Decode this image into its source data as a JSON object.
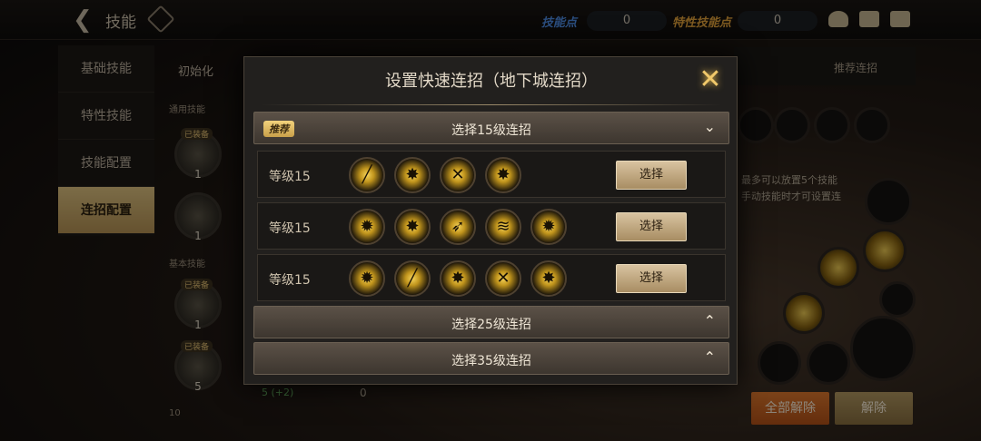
{
  "topbar": {
    "title": "技能",
    "skill_points_label": "技能点",
    "skill_points_value": "0",
    "trait_points_label": "特性技能点",
    "trait_points_value": "0"
  },
  "nav": {
    "items": [
      {
        "label": "基础技能"
      },
      {
        "label": "特性技能"
      },
      {
        "label": "技能配置"
      },
      {
        "label": "连招配置"
      }
    ]
  },
  "background": {
    "reset_label": "初始化",
    "section_common": "通用技能",
    "section_basic": "基本技能",
    "equipped_badge": "已装备",
    "skill_levels": [
      "1",
      "1",
      "1",
      "5"
    ],
    "recommend_link": "推荐连招",
    "hint_line1": "最多可以放置5个技能",
    "hint_line2": "手动技能时才可设置连",
    "row_value": "0",
    "plus_value": "5 (+2)",
    "bottom_num": "10",
    "btn_remove_all": "全部解除",
    "btn_remove": "解除"
  },
  "modal": {
    "title": "设置快速连招（地下城连招）",
    "recommend_tag": "推荐",
    "group15": "选择15级连招",
    "group25": "选择25级连招",
    "group35": "选择35级连招",
    "rows": [
      {
        "level": "等级15",
        "select": "选择",
        "icons": [
          "slash-icon",
          "burst-icon",
          "cross-slash-icon",
          "burst-icon"
        ]
      },
      {
        "level": "等级15",
        "select": "选择",
        "icons": [
          "shout-icon",
          "burst-icon",
          "uppercut-icon",
          "sweep-icon",
          "shout-icon"
        ]
      },
      {
        "level": "等级15",
        "select": "选择",
        "icons": [
          "shout-icon",
          "slash-icon",
          "burst-icon",
          "cross-slash-icon",
          "burst-icon"
        ]
      }
    ]
  },
  "colors": {
    "accent_gold": "#e1c582",
    "accent_orange": "#e17a2e"
  }
}
